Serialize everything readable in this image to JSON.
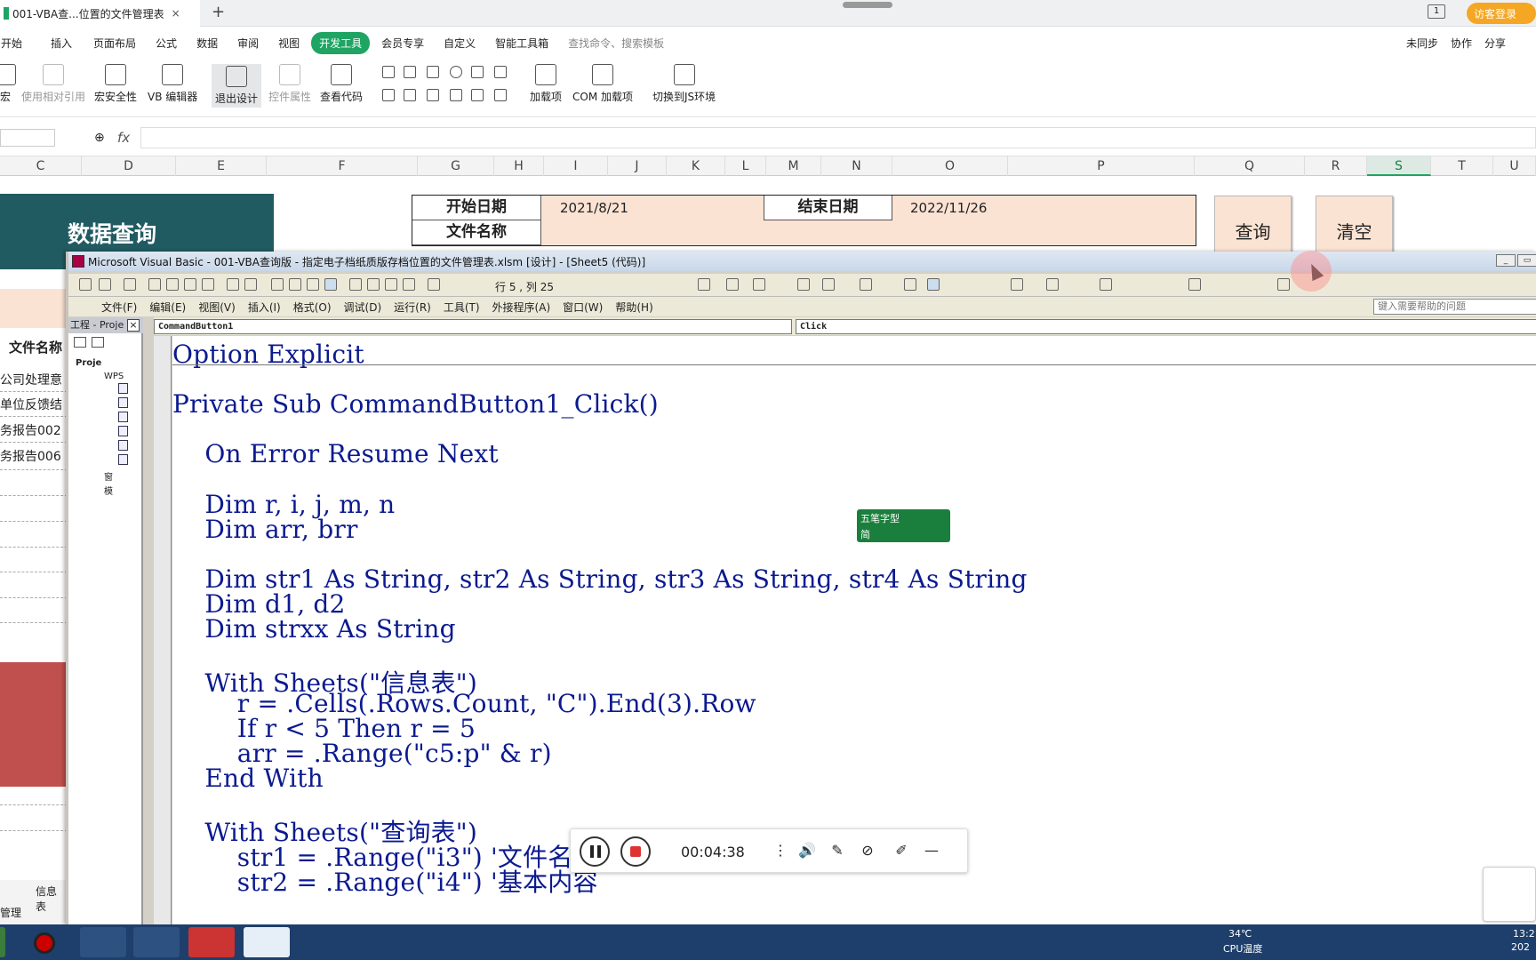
{
  "browser": {
    "tab_title": "001-VBA查...位置的文件管理表",
    "tab_close": "×",
    "new_tab": "+",
    "login": "访客登录",
    "tab_count": "1"
  },
  "menu": {
    "items": [
      "开始",
      "插入",
      "页面布局",
      "公式",
      "数据",
      "审阅",
      "视图",
      "开发工具",
      "会员专享",
      "自定义",
      "智能工具箱"
    ],
    "active": "开发工具",
    "search_placeholder": "查找命令、搜索模板",
    "right": [
      "未同步",
      "协作",
      "分享"
    ]
  },
  "ribbon": {
    "buttons": [
      "宏",
      "使用相对引用",
      "宏安全性",
      "VB 编辑器",
      "退出设计",
      "控件属性",
      "查看代码",
      "加载项",
      "COM 加载项",
      "切换到JS环境"
    ]
  },
  "formula": {
    "fx": "fx",
    "value": ""
  },
  "columns": [
    "C",
    "D",
    "E",
    "F",
    "G",
    "H",
    "I",
    "J",
    "K",
    "L",
    "M",
    "N",
    "O",
    "P",
    "Q",
    "R",
    "S",
    "T",
    "U"
  ],
  "selected_column": "S",
  "sheet": {
    "banner": "数据查询",
    "labels": {
      "start_date": "开始日期",
      "end_date": "结束日期",
      "file_name": "文件名称"
    },
    "values": {
      "start_date": "2021/8/21",
      "end_date": "2022/11/26",
      "file_name": ""
    },
    "buttons": {
      "query": "查询",
      "clear": "清空"
    },
    "left_col_header": "文件名称",
    "left_rows": [
      "公司处理意",
      "单位反馈结",
      "务报告002",
      "务报告006"
    ],
    "tabs": [
      "信息表",
      "管理"
    ]
  },
  "vba": {
    "title": "Microsoft Visual Basic - 001-VBA查询版 - 指定电子档纸质版存档位置的文件管理表.xlsm [设计] - [Sheet5 (代码)]",
    "cursor_pos": "行 5 , 列 25",
    "menu": [
      "文件(F)",
      "编辑(E)",
      "视图(V)",
      "插入(I)",
      "格式(O)",
      "调试(D)",
      "运行(R)",
      "工具(T)",
      "外接程序(A)",
      "窗口(W)",
      "帮助(H)"
    ],
    "help_placeholder": "键入需要帮助的问题",
    "project_title": "工程 - Proje",
    "project_nodes": [
      "Proje",
      "WPS",
      "窗",
      "模"
    ],
    "object_combo": "CommandButton1",
    "proc_combo": "Click",
    "code": [
      "Option Explicit",
      "Private Sub CommandButton1_Click()",
      "    On Error Resume Next",
      "    Dim r, i, j, m, n",
      "    Dim arr, brr",
      "    Dim str1 As String, str2 As String, str3 As String, str4 As String",
      "    Dim d1, d2",
      "    Dim strxx As String",
      "    With Sheets(\"信息表\")",
      "        r = .Cells(.Rows.Count, \"C\").End(3).Row",
      "        If r < 5 Then r = 5",
      "        arr = .Range(\"c5:p\" & r)",
      "    End With",
      "    With Sheets(\"查询表\")",
      "        str1 = .Range(\"i3\") '文件名称",
      "        str2 = .Range(\"i4\") '基本内容"
    ]
  },
  "ime": {
    "line1": "五笔字型",
    "line2": "简"
  },
  "recorder": {
    "time": "00:04:38"
  },
  "tray": {
    "temp": "34℃",
    "cpu": "CPU温度",
    "clock_top": "13:2",
    "clock_bottom": "202"
  },
  "colors": {
    "brand_green": "#1fa463",
    "banner": "#215b62",
    "peach": "#fbe3d3",
    "red_block": "#c0504d",
    "taskbar": "#1e3f6b"
  }
}
